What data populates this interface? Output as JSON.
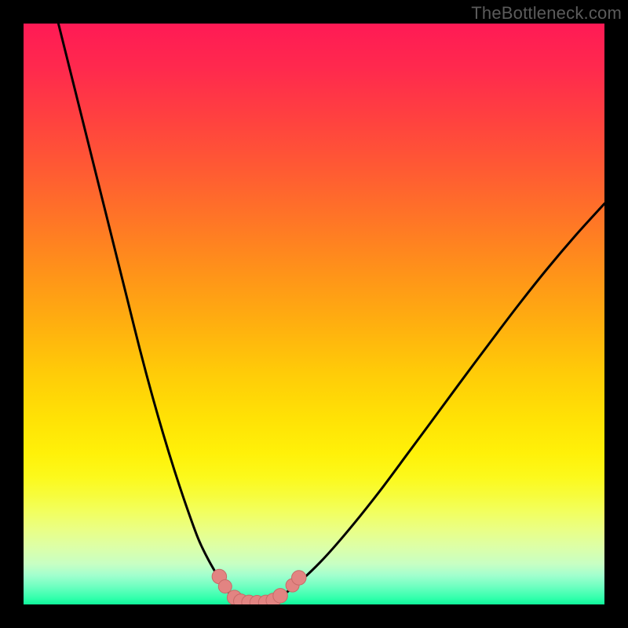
{
  "watermark": "TheBottleneck.com",
  "colors": {
    "frame": "#000000",
    "curve_stroke": "#000000",
    "marker_fill": "#e28482",
    "marker_stroke": "#c66a68"
  },
  "chart_data": {
    "type": "line",
    "title": "",
    "xlabel": "",
    "ylabel": "",
    "xlim": [
      0,
      100
    ],
    "ylim": [
      0,
      100
    ],
    "grid": false,
    "legend": false,
    "series": [
      {
        "name": "left-branch",
        "x": [
          6,
          8,
          10,
          12,
          14,
          16,
          18,
          20,
          22,
          24,
          26,
          28,
          30,
          31.5,
          33,
          34.5,
          36
        ],
        "y": [
          100,
          92,
          84,
          76,
          68,
          60,
          52,
          44,
          36.5,
          29.5,
          23,
          17,
          11.5,
          8.3,
          5.6,
          3.2,
          1.2
        ]
      },
      {
        "name": "valley-floor",
        "x": [
          36,
          37,
          38,
          39,
          40,
          41,
          42,
          43,
          44
        ],
        "y": [
          1.2,
          0.6,
          0.35,
          0.3,
          0.3,
          0.35,
          0.5,
          0.8,
          1.3
        ]
      },
      {
        "name": "right-branch",
        "x": [
          44,
          46,
          48,
          51,
          54,
          58,
          62,
          66,
          70,
          75,
          80,
          85,
          90,
          95,
          100
        ],
        "y": [
          1.3,
          2.6,
          4.3,
          7.2,
          10.5,
          15.3,
          20.4,
          25.8,
          31.2,
          38.0,
          44.7,
          51.3,
          57.6,
          63.5,
          69.0
        ]
      }
    ],
    "markers": [
      {
        "x": 33.7,
        "y": 4.8,
        "r": 1.25
      },
      {
        "x": 34.7,
        "y": 3.1,
        "r": 1.15
      },
      {
        "x": 36.3,
        "y": 1.2,
        "r": 1.25
      },
      {
        "x": 37.4,
        "y": 0.55,
        "r": 1.25
      },
      {
        "x": 38.8,
        "y": 0.35,
        "r": 1.25
      },
      {
        "x": 40.2,
        "y": 0.3,
        "r": 1.25
      },
      {
        "x": 41.7,
        "y": 0.35,
        "r": 1.25
      },
      {
        "x": 43.0,
        "y": 0.7,
        "r": 1.25
      },
      {
        "x": 44.2,
        "y": 1.5,
        "r": 1.25
      },
      {
        "x": 46.3,
        "y": 3.3,
        "r": 1.15
      },
      {
        "x": 47.4,
        "y": 4.6,
        "r": 1.25
      }
    ]
  }
}
